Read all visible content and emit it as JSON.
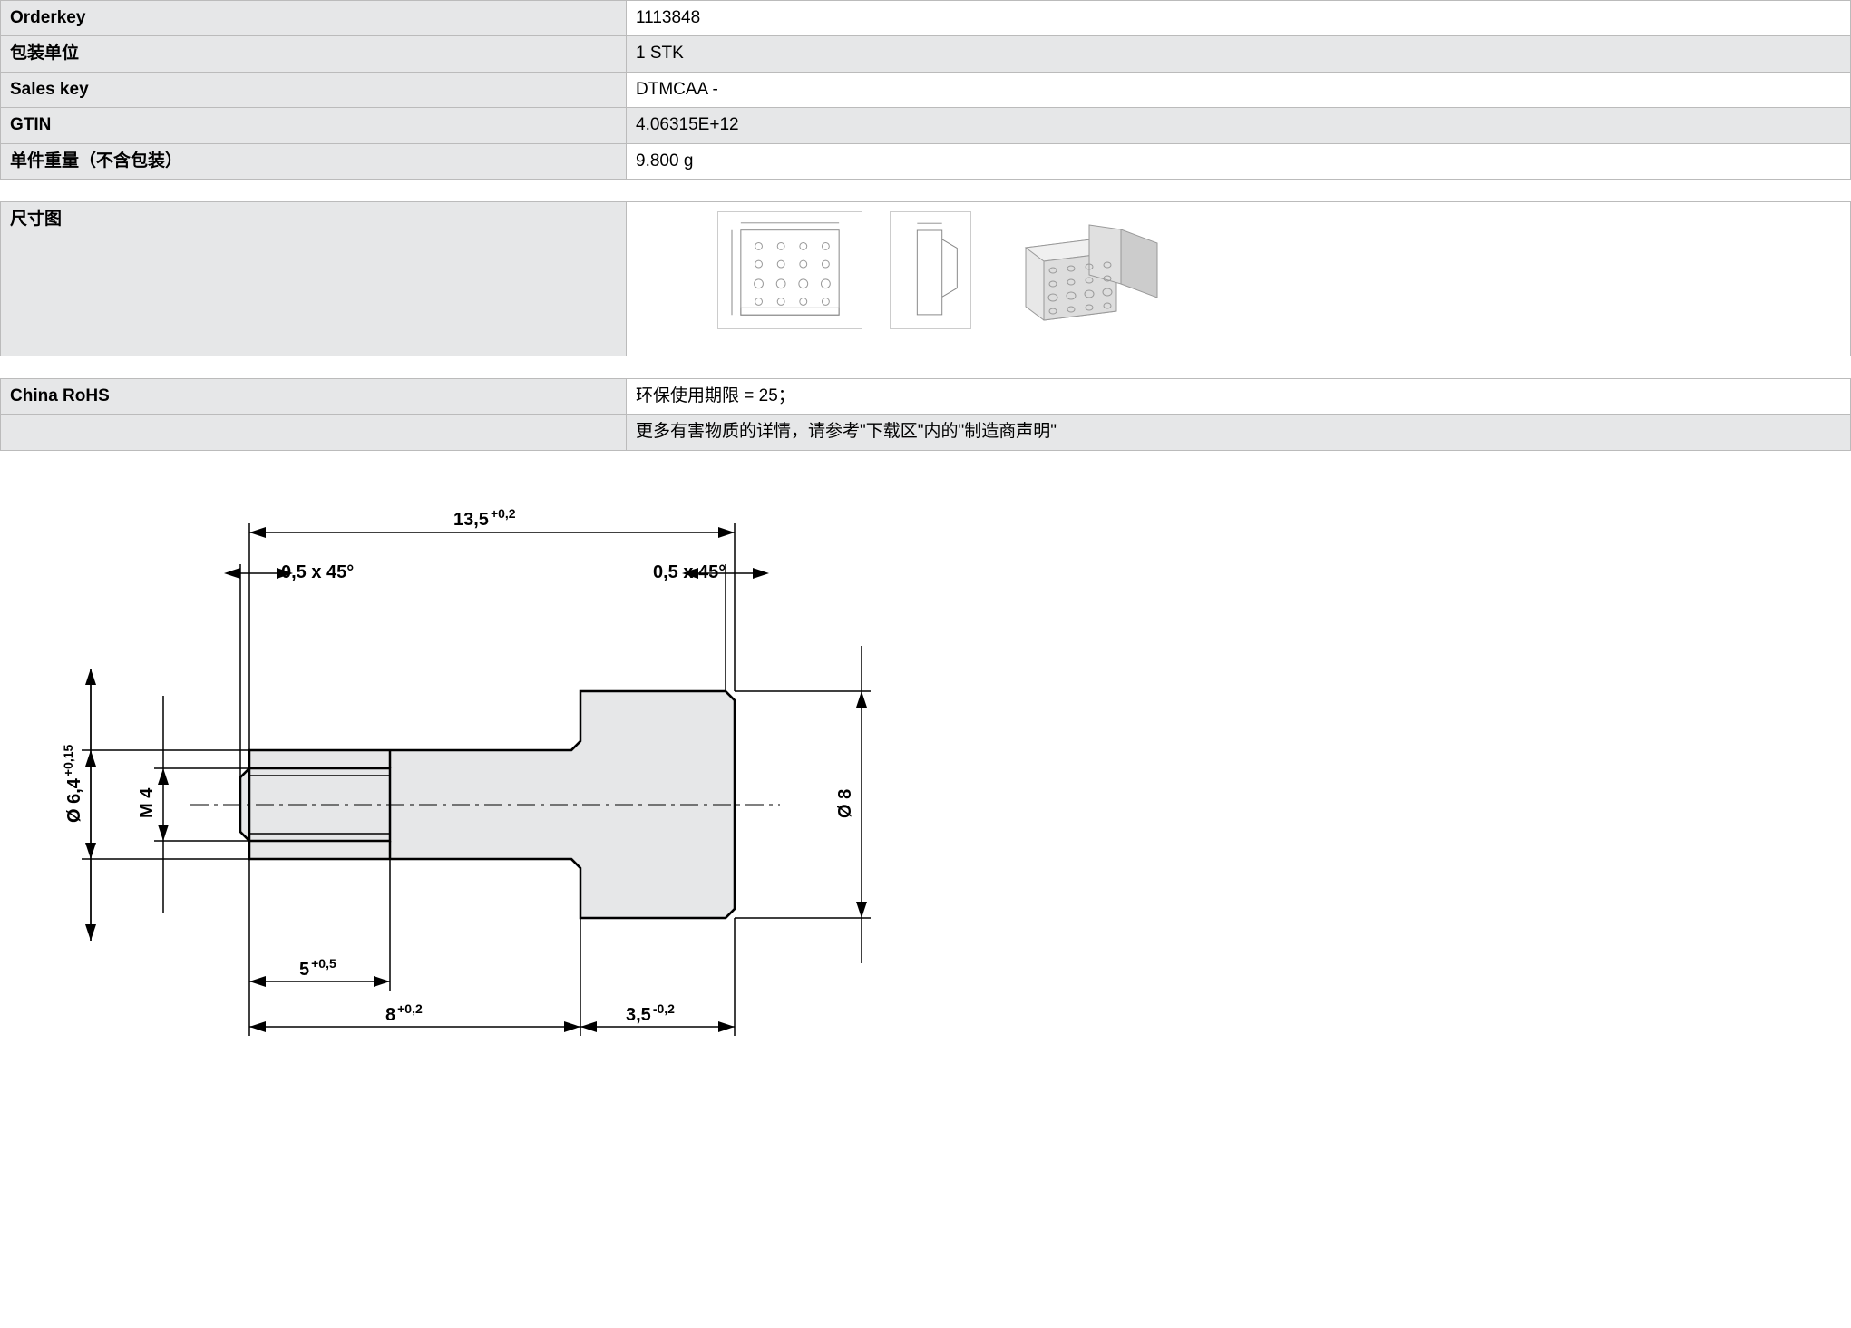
{
  "spec_table": {
    "rows": [
      {
        "label": "Orderkey",
        "value": "1113848"
      },
      {
        "label": "包装单位",
        "value": "1 STK"
      },
      {
        "label": "Sales key",
        "value": "DTMCAA -"
      },
      {
        "label": "GTIN",
        "value": "4.06315E+12"
      },
      {
        "label": "单件重量（不含包装）",
        "value": "9.800 g"
      }
    ]
  },
  "dim_section": {
    "header": "尺寸图"
  },
  "rohs_section": {
    "rows": [
      {
        "label": "China RoHS",
        "value": "环保使用期限 = 25；"
      },
      {
        "label": "",
        "value": "更多有害物质的详情，请参考\"下载区\"内的\"制造商声明\""
      }
    ]
  },
  "drawing": {
    "dims": {
      "d1": "13,5",
      "d1_tol": "+0,2",
      "chamfer_left": "0,5 x 45°",
      "chamfer_right": "0,5 x 45°",
      "dia_left": "Ø 6,4",
      "dia_left_tol": "+0,15",
      "thread": "M 4",
      "dia_right": "Ø 8",
      "l1": "5",
      "l1_tol": "+0,5",
      "l2": "8",
      "l2_tol": "+0,2",
      "l3": "3,5",
      "l3_tol": "-0,2"
    }
  }
}
